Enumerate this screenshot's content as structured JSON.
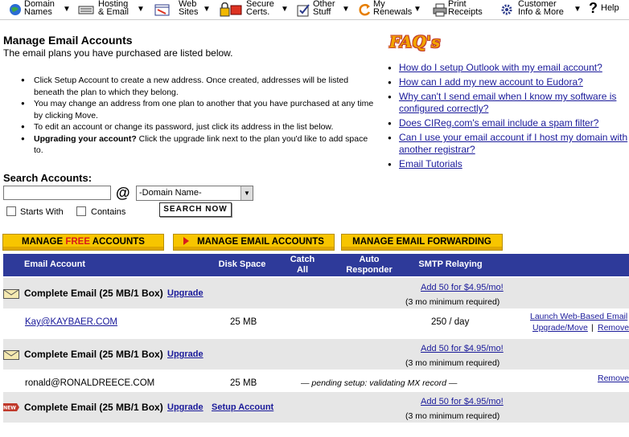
{
  "nav": [
    {
      "line1": "Domain",
      "line2": "Names"
    },
    {
      "line1": "Hosting",
      "line2": "& Email"
    },
    {
      "line1": "Web",
      "line2": "Sites"
    },
    {
      "line1": "Secure",
      "line2": "Certs."
    },
    {
      "line1": "Other",
      "line2": "Stuff"
    },
    {
      "line1": "My",
      "line2": "Renewals"
    },
    {
      "line1": "Print",
      "line2": "Receipts"
    },
    {
      "line1": "Customer",
      "line2": "Info & More"
    },
    {
      "line1": "Help",
      "line2": ""
    }
  ],
  "page": {
    "title": "Manage Email Accounts",
    "subtitle": "The email plans you have purchased are listed below."
  },
  "bullets": {
    "b1": "Click Setup Account to create a new address. Once created, addresses will be listed beneath the plan to which they belong.",
    "b2": "You may change an address from one plan to another that you have purchased at any time by clicking Move.",
    "b3": "To edit an account or change its password, just click its address in the list below.",
    "b4_bold": "Upgrading your account?",
    "b4_rest": " Click the upgrade link next to the plan you'd like to add space to."
  },
  "faq": {
    "logo": "FAQ's",
    "items": [
      "How do I setup Outlook with my email account?",
      "How can I add my new account to Eudora?",
      "Why can't I send email when I know my software is configured correctly?",
      "Does CIReg.com's email include a spam filter?",
      "Can I use your email account if I host my domain with another registrar?",
      "Email Tutorials"
    ]
  },
  "search": {
    "label": "Search Accounts:",
    "at": "@",
    "domain_value": "-Domain Name-",
    "starts_with": "Starts With",
    "contains": "Contains",
    "button": "SEARCH NOW"
  },
  "tabs": {
    "free_a": "MANAGE ",
    "free_b": "FREE",
    "free_c": " ACCOUNTS",
    "email": "MANAGE EMAIL ACCOUNTS",
    "forwarding": "MANAGE EMAIL FORWARDING"
  },
  "table": {
    "col_email": "Email Account",
    "col_disk": "Disk Space",
    "col_catch1": "Catch",
    "col_catch2": "All",
    "col_auto1": "Auto",
    "col_auto2": "Responder",
    "col_smtp": "SMTP Relaying"
  },
  "plans": [
    {
      "name": "Complete Email (25 MB/1 Box)",
      "upgrade": "Upgrade",
      "add": "Add 50 for $4.95/mo!",
      "min": "(3 mo minimum required)"
    },
    {
      "name": "Complete Email (25 MB/1 Box)",
      "upgrade": "Upgrade",
      "add": "Add 50 for $4.95/mo!",
      "min": "(3 mo minimum required)"
    },
    {
      "name": "Complete Email (25 MB/1 Box)",
      "upgrade": "Upgrade",
      "setup": "Setup Account",
      "add": "Add 50 for $4.95/mo!",
      "min": "(3 mo minimum required)",
      "badge": "NEW"
    }
  ],
  "accounts": [
    {
      "email": "Kay@KAYBAER.COM",
      "disk": "25 MB",
      "smtp": "250 / day",
      "launch": "Launch Web-Based Email",
      "move": "Upgrade/Move",
      "sep": "|",
      "remove": "Remove"
    },
    {
      "email": "ronald@RONALDREECE.COM",
      "disk": "25 MB",
      "pending": "— pending setup: validating MX record —",
      "remove": "Remove"
    }
  ]
}
